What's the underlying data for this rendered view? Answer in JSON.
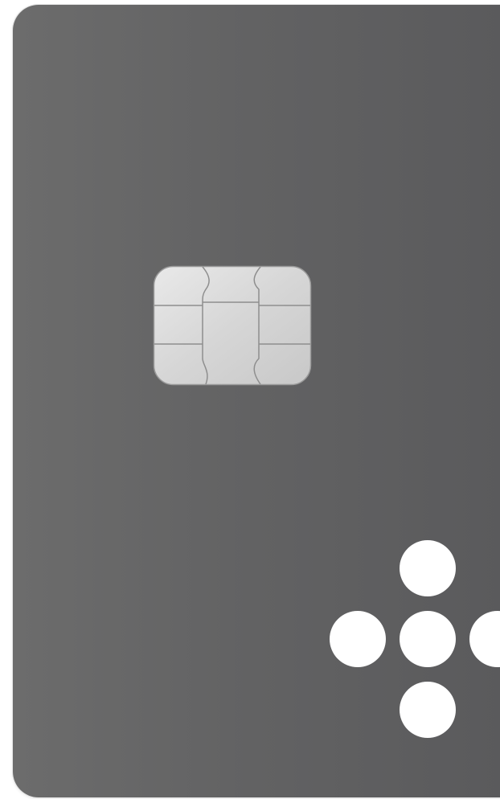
{
  "card": {
    "color": "#626263",
    "chip": {
      "icon": "emv-chip-icon",
      "color": "#d9d9d9"
    },
    "logo": {
      "icon": "plus-dots-logo-icon",
      "color": "#ffffff",
      "dot_count": 5
    }
  }
}
